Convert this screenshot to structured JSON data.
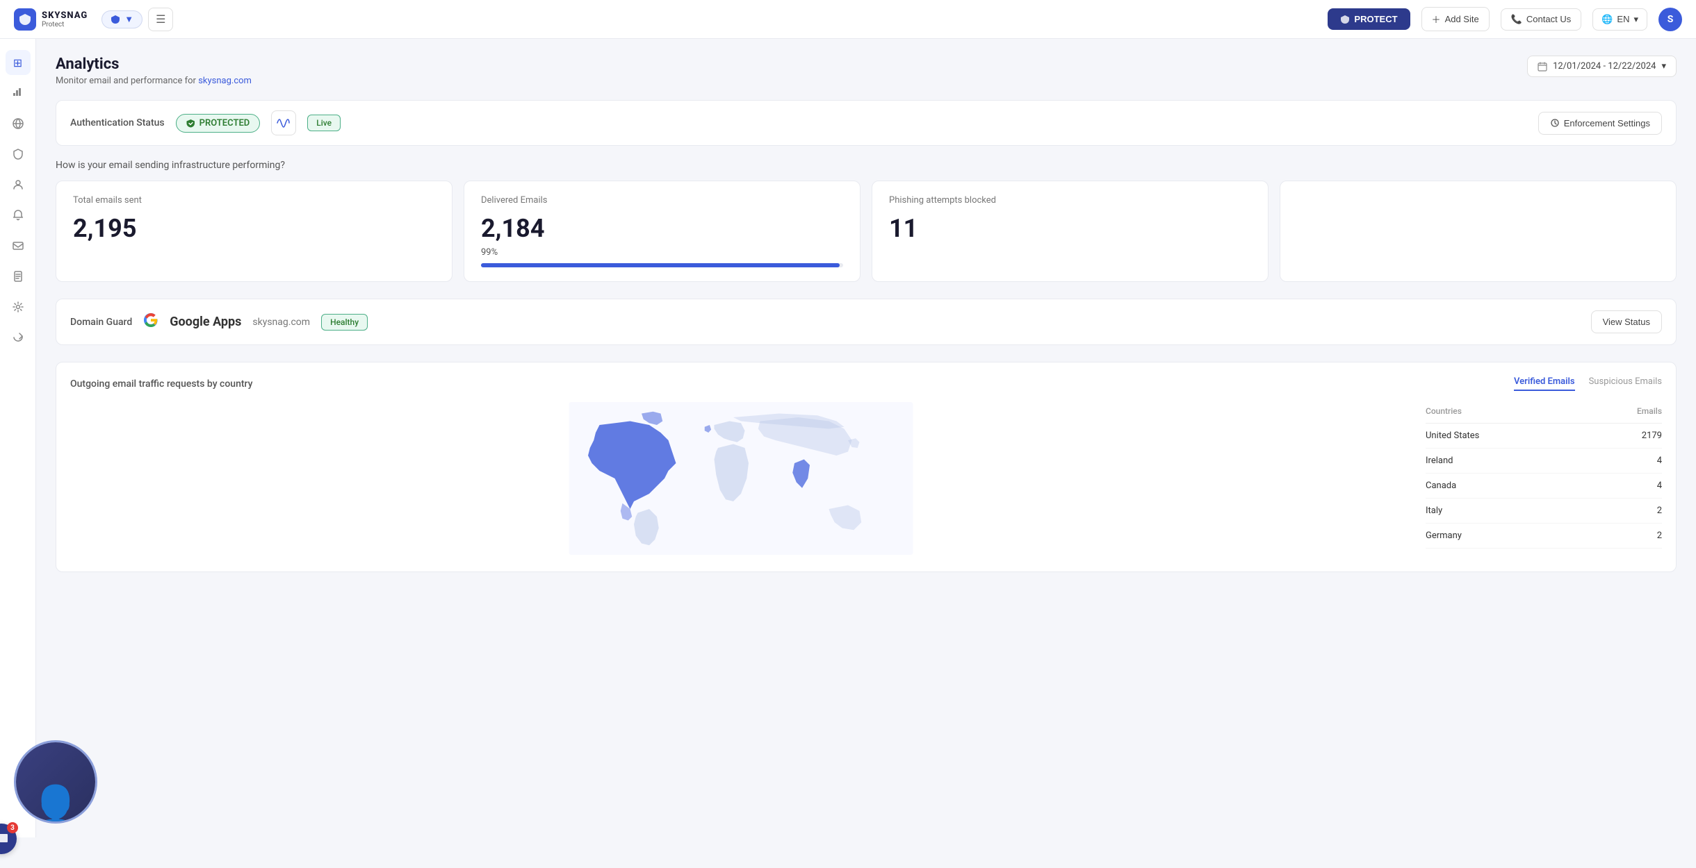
{
  "app": {
    "name": "SKYSNAG",
    "sub": "Protect",
    "protect_btn": "PROTECT",
    "add_site_btn": "Add Site",
    "contact_btn": "Contact Us",
    "lang": "EN",
    "avatar_initial": "S"
  },
  "page": {
    "title": "Analytics",
    "subtitle_prefix": "Monitor email and performance for",
    "domain_link": "skysnag.com",
    "date_range": "12/01/2024 - 12/22/2024"
  },
  "auth_status": {
    "label": "Authentication Status",
    "badge": "PROTECTED",
    "live": "Live",
    "enforcement_btn": "Enforcement Settings"
  },
  "stats": {
    "question": "How is your email sending infrastructure performing?",
    "total_emails": {
      "label": "Total emails sent",
      "value": "2,195"
    },
    "delivered": {
      "label": "Delivered Emails",
      "value": "2,184",
      "percent": "99%",
      "progress": 99
    },
    "phishing": {
      "label": "Phishing attempts blocked",
      "value": "11"
    }
  },
  "domain_guard": {
    "label": "Domain Guard",
    "provider": "Google Apps",
    "domain": "skysnag.com",
    "status": "Healthy",
    "view_btn": "View Status"
  },
  "traffic": {
    "title": "Outgoing email traffic requests by country",
    "tabs": [
      "Verified Emails",
      "Suspicious Emails"
    ],
    "active_tab": 0,
    "table": {
      "col_country": "Countries",
      "col_emails": "Emails",
      "rows": [
        {
          "country": "United States",
          "emails": "2179"
        },
        {
          "country": "Ireland",
          "emails": "4"
        },
        {
          "country": "Canada",
          "emails": "4"
        },
        {
          "country": "Italy",
          "emails": "2"
        },
        {
          "country": "Germany",
          "emails": "2"
        }
      ]
    }
  },
  "chat": {
    "badge": "3"
  },
  "sidebar": {
    "icons": [
      {
        "name": "home-icon",
        "symbol": "⊞"
      },
      {
        "name": "chart-icon",
        "symbol": "📊"
      },
      {
        "name": "globe-icon",
        "symbol": "🌐"
      },
      {
        "name": "shield-icon",
        "symbol": "🛡"
      },
      {
        "name": "user-icon",
        "symbol": "👤"
      },
      {
        "name": "bell-icon",
        "symbol": "🔔"
      },
      {
        "name": "mail-icon",
        "symbol": "✉"
      },
      {
        "name": "report-icon",
        "symbol": "📋"
      },
      {
        "name": "settings-icon",
        "symbol": "⚙"
      },
      {
        "name": "share-icon",
        "symbol": "↗"
      }
    ]
  }
}
